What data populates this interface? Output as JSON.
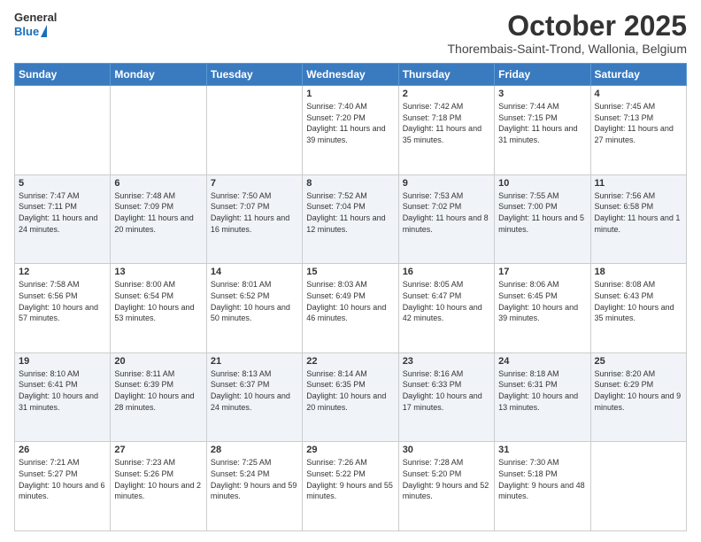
{
  "logo": {
    "general": "General",
    "blue": "Blue"
  },
  "title": "October 2025",
  "subtitle": "Thorembais-Saint-Trond, Wallonia, Belgium",
  "days": [
    "Sunday",
    "Monday",
    "Tuesday",
    "Wednesday",
    "Thursday",
    "Friday",
    "Saturday"
  ],
  "weeks": [
    [
      {
        "day": "",
        "text": ""
      },
      {
        "day": "",
        "text": ""
      },
      {
        "day": "",
        "text": ""
      },
      {
        "day": "1",
        "text": "Sunrise: 7:40 AM\nSunset: 7:20 PM\nDaylight: 11 hours and 39 minutes."
      },
      {
        "day": "2",
        "text": "Sunrise: 7:42 AM\nSunset: 7:18 PM\nDaylight: 11 hours and 35 minutes."
      },
      {
        "day": "3",
        "text": "Sunrise: 7:44 AM\nSunset: 7:15 PM\nDaylight: 11 hours and 31 minutes."
      },
      {
        "day": "4",
        "text": "Sunrise: 7:45 AM\nSunset: 7:13 PM\nDaylight: 11 hours and 27 minutes."
      }
    ],
    [
      {
        "day": "5",
        "text": "Sunrise: 7:47 AM\nSunset: 7:11 PM\nDaylight: 11 hours and 24 minutes."
      },
      {
        "day": "6",
        "text": "Sunrise: 7:48 AM\nSunset: 7:09 PM\nDaylight: 11 hours and 20 minutes."
      },
      {
        "day": "7",
        "text": "Sunrise: 7:50 AM\nSunset: 7:07 PM\nDaylight: 11 hours and 16 minutes."
      },
      {
        "day": "8",
        "text": "Sunrise: 7:52 AM\nSunset: 7:04 PM\nDaylight: 11 hours and 12 minutes."
      },
      {
        "day": "9",
        "text": "Sunrise: 7:53 AM\nSunset: 7:02 PM\nDaylight: 11 hours and 8 minutes."
      },
      {
        "day": "10",
        "text": "Sunrise: 7:55 AM\nSunset: 7:00 PM\nDaylight: 11 hours and 5 minutes."
      },
      {
        "day": "11",
        "text": "Sunrise: 7:56 AM\nSunset: 6:58 PM\nDaylight: 11 hours and 1 minute."
      }
    ],
    [
      {
        "day": "12",
        "text": "Sunrise: 7:58 AM\nSunset: 6:56 PM\nDaylight: 10 hours and 57 minutes."
      },
      {
        "day": "13",
        "text": "Sunrise: 8:00 AM\nSunset: 6:54 PM\nDaylight: 10 hours and 53 minutes."
      },
      {
        "day": "14",
        "text": "Sunrise: 8:01 AM\nSunset: 6:52 PM\nDaylight: 10 hours and 50 minutes."
      },
      {
        "day": "15",
        "text": "Sunrise: 8:03 AM\nSunset: 6:49 PM\nDaylight: 10 hours and 46 minutes."
      },
      {
        "day": "16",
        "text": "Sunrise: 8:05 AM\nSunset: 6:47 PM\nDaylight: 10 hours and 42 minutes."
      },
      {
        "day": "17",
        "text": "Sunrise: 8:06 AM\nSunset: 6:45 PM\nDaylight: 10 hours and 39 minutes."
      },
      {
        "day": "18",
        "text": "Sunrise: 8:08 AM\nSunset: 6:43 PM\nDaylight: 10 hours and 35 minutes."
      }
    ],
    [
      {
        "day": "19",
        "text": "Sunrise: 8:10 AM\nSunset: 6:41 PM\nDaylight: 10 hours and 31 minutes."
      },
      {
        "day": "20",
        "text": "Sunrise: 8:11 AM\nSunset: 6:39 PM\nDaylight: 10 hours and 28 minutes."
      },
      {
        "day": "21",
        "text": "Sunrise: 8:13 AM\nSunset: 6:37 PM\nDaylight: 10 hours and 24 minutes."
      },
      {
        "day": "22",
        "text": "Sunrise: 8:14 AM\nSunset: 6:35 PM\nDaylight: 10 hours and 20 minutes."
      },
      {
        "day": "23",
        "text": "Sunrise: 8:16 AM\nSunset: 6:33 PM\nDaylight: 10 hours and 17 minutes."
      },
      {
        "day": "24",
        "text": "Sunrise: 8:18 AM\nSunset: 6:31 PM\nDaylight: 10 hours and 13 minutes."
      },
      {
        "day": "25",
        "text": "Sunrise: 8:20 AM\nSunset: 6:29 PM\nDaylight: 10 hours and 9 minutes."
      }
    ],
    [
      {
        "day": "26",
        "text": "Sunrise: 7:21 AM\nSunset: 5:27 PM\nDaylight: 10 hours and 6 minutes."
      },
      {
        "day": "27",
        "text": "Sunrise: 7:23 AM\nSunset: 5:26 PM\nDaylight: 10 hours and 2 minutes."
      },
      {
        "day": "28",
        "text": "Sunrise: 7:25 AM\nSunset: 5:24 PM\nDaylight: 9 hours and 59 minutes."
      },
      {
        "day": "29",
        "text": "Sunrise: 7:26 AM\nSunset: 5:22 PM\nDaylight: 9 hours and 55 minutes."
      },
      {
        "day": "30",
        "text": "Sunrise: 7:28 AM\nSunset: 5:20 PM\nDaylight: 9 hours and 52 minutes."
      },
      {
        "day": "31",
        "text": "Sunrise: 7:30 AM\nSunset: 5:18 PM\nDaylight: 9 hours and 48 minutes."
      },
      {
        "day": "",
        "text": ""
      }
    ]
  ]
}
